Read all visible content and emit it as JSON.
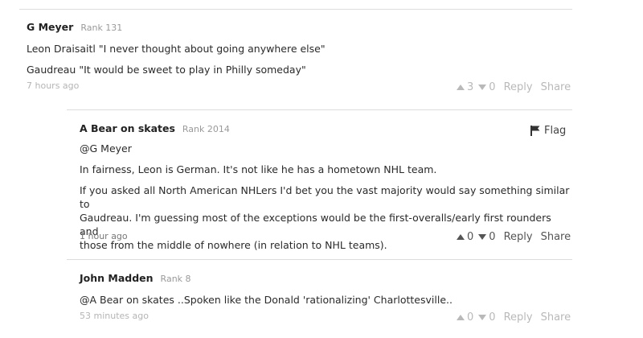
{
  "comments": [
    {
      "author": "G Meyer",
      "rank": "Rank 131",
      "lines": [
        "Leon Draisaitl \"I never thought about going anywhere else\"",
        "Gaudreau \"It would be sweet to play in Philly someday\""
      ],
      "time": "7 hours ago",
      "upvotes": "3",
      "downvotes": "0",
      "reply": "Reply",
      "share": "Share"
    },
    {
      "author": "A Bear on skates",
      "rank": "Rank 2014",
      "flag": "Flag",
      "mention": "@G Meyer",
      "lines": [
        "In fairness, Leon is German. It's not like he has a hometown NHL team.",
        "If you asked all North American NHLers I'd bet you the vast majority would say something similar to",
        "Gaudreau. I'm guessing most of the exceptions would be the first-overalls/early first rounders and",
        "those from the middle of nowhere (in relation to NHL teams)."
      ],
      "time": "1 hour ago",
      "upvotes": "0",
      "downvotes": "0",
      "reply": "Reply",
      "share": "Share"
    },
    {
      "author": "John Madden",
      "rank": "Rank 8",
      "lines": [
        "@A Bear on skates ..Spoken like the Donald 'rationalizing' Charlottesville.."
      ],
      "time": "53 minutes ago",
      "upvotes": "0",
      "downvotes": "0",
      "reply": "Reply",
      "share": "Share"
    }
  ]
}
